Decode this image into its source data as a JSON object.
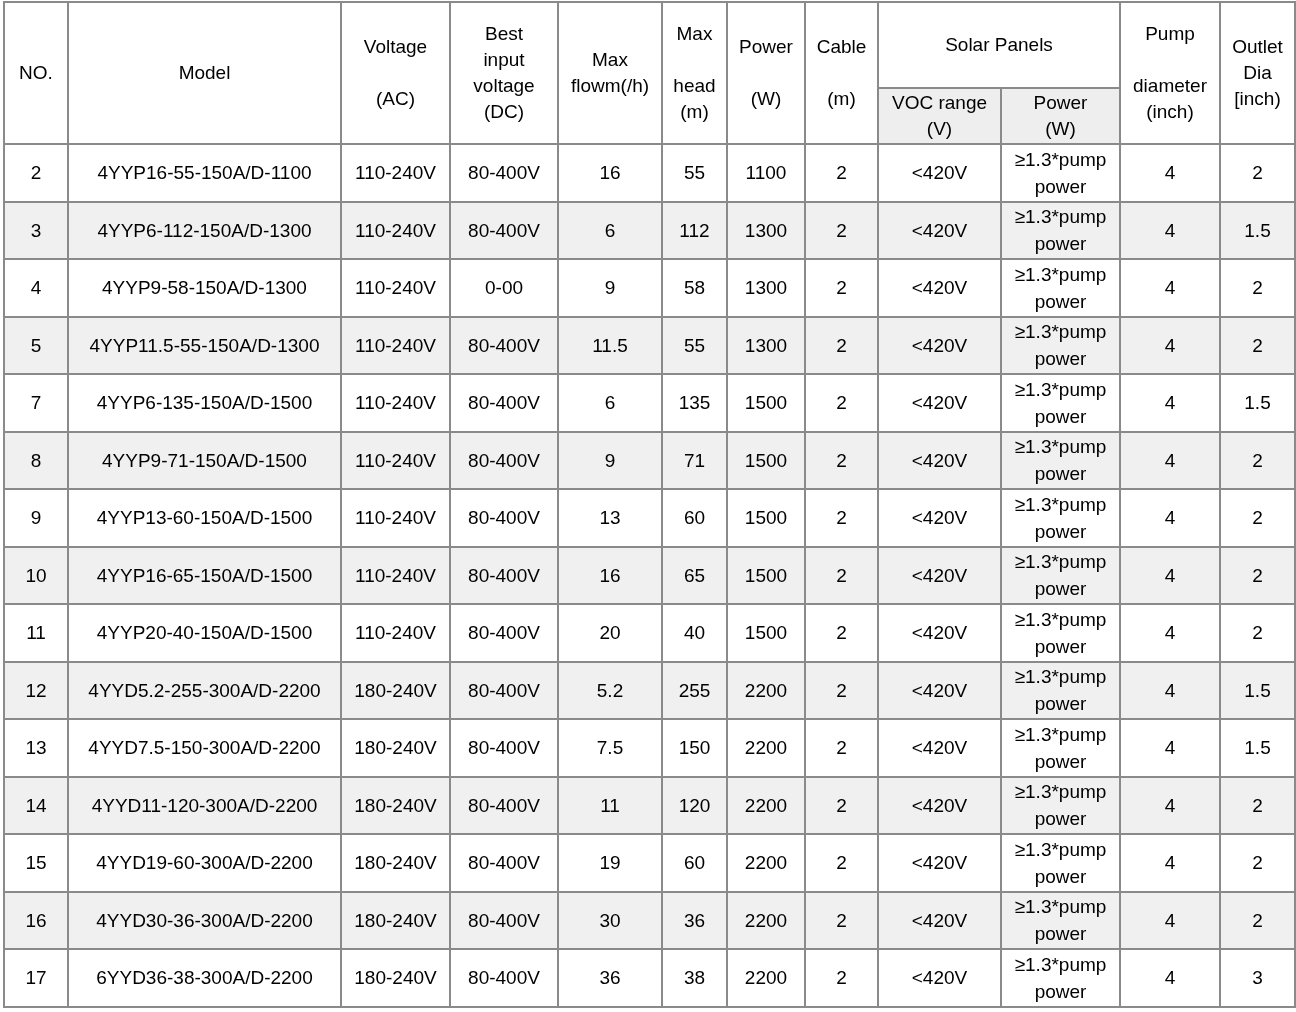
{
  "table": {
    "header_rows": [
      [
        {
          "label": "NO.",
          "rowspan": 2
        },
        {
          "label": "Model",
          "rowspan": 2
        },
        {
          "label": "Voltage\n\n(AC)",
          "rowspan": 2
        },
        {
          "label": "Best\ninput\nvoltage\n(DC)",
          "rowspan": 2
        },
        {
          "label": "Max\nflowm(/h)",
          "rowspan": 2
        },
        {
          "label": "Max\n\nhead\n(m)",
          "rowspan": 2
        },
        {
          "label": "Power\n\n(W)",
          "rowspan": 2
        },
        {
          "label": "Cable\n\n(m)",
          "rowspan": 2
        },
        {
          "label": "Solar Panels",
          "colspan": 2
        },
        {
          "label": "Pump\n\ndiameter\n(inch)",
          "rowspan": 2
        },
        {
          "label": "Outlet\nDia\n[inch)",
          "rowspan": 2
        }
      ],
      [
        {
          "label": "VOC range\n(V)"
        },
        {
          "label": "Power\n(W)"
        }
      ]
    ],
    "rows": [
      [
        "2",
        "4YYP16-55-150A/D-1100",
        "110-240V",
        "80-400V",
        "16",
        "55",
        "1100",
        "2",
        "<420V",
        "≥1.3*pump power",
        "4",
        "2"
      ],
      [
        "3",
        "4YYP6-112-150A/D-1300",
        "110-240V",
        "80-400V",
        "6",
        "112",
        "1300",
        "2",
        "<420V",
        "≥1.3*pump power",
        "4",
        "1.5"
      ],
      [
        "4",
        "4YYP9-58-150A/D-1300",
        "110-240V",
        "0-00",
        "9",
        "58",
        "1300",
        "2",
        "<420V",
        "≥1.3*pump power",
        "4",
        "2"
      ],
      [
        "5",
        "4YYP11.5-55-150A/D-1300",
        "110-240V",
        "80-400V",
        "11.5",
        "55",
        "1300",
        "2",
        "<420V",
        "≥1.3*pump power",
        "4",
        "2"
      ],
      [
        "7",
        "4YYP6-135-150A/D-1500",
        "110-240V",
        "80-400V",
        "6",
        "135",
        "1500",
        "2",
        "<420V",
        "≥1.3*pump power",
        "4",
        "1.5"
      ],
      [
        "8",
        "4YYP9-71-150A/D-1500",
        "110-240V",
        "80-400V",
        "9",
        "71",
        "1500",
        "2",
        "<420V",
        "≥1.3*pump power",
        "4",
        "2"
      ],
      [
        "9",
        "4YYP13-60-150A/D-1500",
        "110-240V",
        "80-400V",
        "13",
        "60",
        "1500",
        "2",
        "<420V",
        "≥1.3*pump power",
        "4",
        "2"
      ],
      [
        "10",
        "4YYP16-65-150A/D-1500",
        "110-240V",
        "80-400V",
        "16",
        "65",
        "1500",
        "2",
        "<420V",
        "≥1.3*pump power",
        "4",
        "2"
      ],
      [
        "11",
        "4YYP20-40-150A/D-1500",
        "110-240V",
        "80-400V",
        "20",
        "40",
        "1500",
        "2",
        "<420V",
        "≥1.3*pump power",
        "4",
        "2"
      ],
      [
        "12",
        "4YYD5.2-255-300A/D-2200",
        "180-240V",
        "80-400V",
        "5.2",
        "255",
        "2200",
        "2",
        "<420V",
        "≥1.3*pump power",
        "4",
        "1.5"
      ],
      [
        "13",
        "4YYD7.5-150-300A/D-2200",
        "180-240V",
        "80-400V",
        "7.5",
        "150",
        "2200",
        "2",
        "<420V",
        "≥1.3*pump power",
        "4",
        "1.5"
      ],
      [
        "14",
        "4YYD11-120-300A/D-2200",
        "180-240V",
        "80-400V",
        "11",
        "120",
        "2200",
        "2",
        "<420V",
        "≥1.3*pump power",
        "4",
        "2"
      ],
      [
        "15",
        "4YYD19-60-300A/D-2200",
        "180-240V",
        "80-400V",
        "19",
        "60",
        "2200",
        "2",
        "<420V",
        "≥1.3*pump power",
        "4",
        "2"
      ],
      [
        "16",
        "4YYD30-36-300A/D-2200",
        "180-240V",
        "80-400V",
        "30",
        "36",
        "2200",
        "2",
        "<420V",
        "≥1.3*pump power",
        "4",
        "2"
      ],
      [
        "17",
        "6YYD36-38-300A/D-2200",
        "180-240V",
        "80-400V",
        "36",
        "38",
        "2200",
        "2",
        "<420V",
        "≥1.3*pump power",
        "4",
        "3"
      ]
    ]
  }
}
